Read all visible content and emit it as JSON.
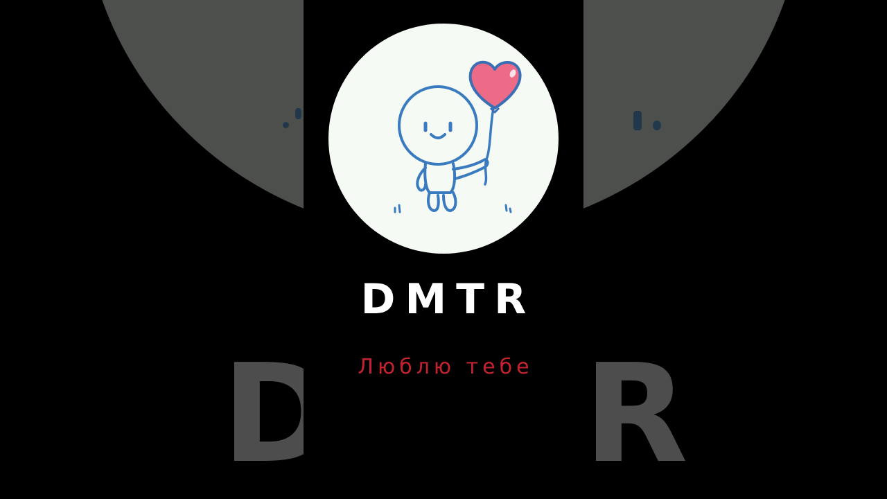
{
  "brand": {
    "title": "DMTR",
    "subtitle": "Люблю тебе"
  },
  "background": {
    "letters": [
      "D",
      "R"
    ]
  },
  "illustration": {
    "figure": "stick-figure-icon",
    "balloon": "heart-balloon-icon"
  },
  "colors": {
    "page_background": "#000000",
    "logo_circle": "#f6faf5",
    "figure_stroke": "#3a7bc0",
    "heart_fill": "#ee6b87",
    "heart_stroke": "#3a6fb5",
    "title": "#ffffff",
    "subtitle": "#c2232f",
    "background_circle": "#4d4f4c",
    "background_letters": "#4d4d4d"
  }
}
